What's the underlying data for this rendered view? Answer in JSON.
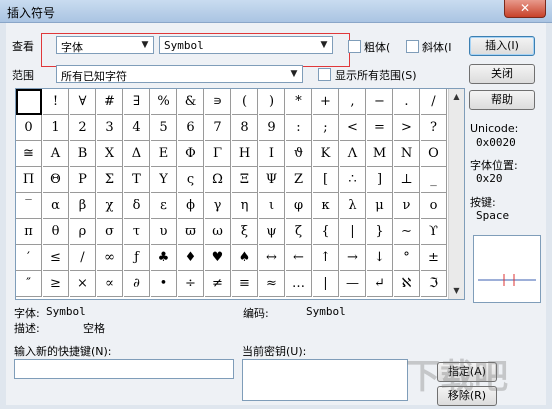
{
  "window": {
    "title": "插入符号",
    "close_glyph": "✕"
  },
  "lookin": {
    "label": "查看",
    "font_type": "字体",
    "font_name": "Symbol",
    "bold_label": "粗体(",
    "italic_label": "斜体(I",
    "bold_checked": false,
    "italic_checked": false
  },
  "range": {
    "label": "范围",
    "value": "所有已知字符",
    "show_all_label": "显示所有范围(S)",
    "show_all_checked": false
  },
  "buttons": {
    "insert": "插入(I)",
    "close": "关闭",
    "help": "帮助",
    "assign": "指定(A)",
    "remove": "移除(R)"
  },
  "info": {
    "unicode_label": "Unicode:",
    "unicode_value": "0x0020",
    "font_pos_label": "字体位置:",
    "font_pos_value": "0x20",
    "key_label": "按键:",
    "key_value": "Space"
  },
  "symbols": [
    [
      " ",
      "!",
      "∀",
      "#",
      "∃",
      "%",
      "&",
      "∍",
      "(",
      ")",
      "*",
      "+",
      ",",
      "−",
      ".",
      "/"
    ],
    [
      "0",
      "1",
      "2",
      "3",
      "4",
      "5",
      "6",
      "7",
      "8",
      "9",
      ":",
      ";",
      "<",
      "=",
      ">",
      "?"
    ],
    [
      "≅",
      "Α",
      "Β",
      "Χ",
      "Δ",
      "Ε",
      "Φ",
      "Γ",
      "Η",
      "Ι",
      "ϑ",
      "Κ",
      "Λ",
      "Μ",
      "Ν",
      "Ο"
    ],
    [
      "Π",
      "Θ",
      "Ρ",
      "Σ",
      "Τ",
      "Υ",
      "ς",
      "Ω",
      "Ξ",
      "Ψ",
      "Ζ",
      "[",
      "∴",
      "]",
      "⊥",
      "_"
    ],
    [
      "‾",
      "α",
      "β",
      "χ",
      "δ",
      "ε",
      "ϕ",
      "γ",
      "η",
      "ι",
      "φ",
      "κ",
      "λ",
      "μ",
      "ν",
      "ο"
    ],
    [
      "π",
      "θ",
      "ρ",
      "σ",
      "τ",
      "υ",
      "ϖ",
      "ω",
      "ξ",
      "ψ",
      "ζ",
      "{",
      "|",
      "}",
      "∼",
      "ϒ"
    ],
    [
      "′",
      "≤",
      "/",
      "∞",
      "ƒ",
      "♣",
      "♦",
      "♥",
      "♠",
      "↔",
      "←",
      "↑",
      "→",
      "↓",
      "°",
      "±"
    ],
    [
      "″",
      "≥",
      "×",
      "∝",
      "∂",
      "•",
      "÷",
      "≠",
      "≡",
      "≈",
      "…",
      "|",
      "—",
      "↵",
      "ℵ",
      "ℑ"
    ]
  ],
  "details": {
    "font_label": "字体:",
    "font_value": "Symbol",
    "code_label": "编码:",
    "code_value": "Symbol",
    "desc_label": "描述:",
    "desc_value": "空格"
  },
  "shortcut": {
    "new_key_label": "输入新的快捷键(N):",
    "current_keys_label": "当前密钥(U):"
  },
  "watermark": "下载吧"
}
